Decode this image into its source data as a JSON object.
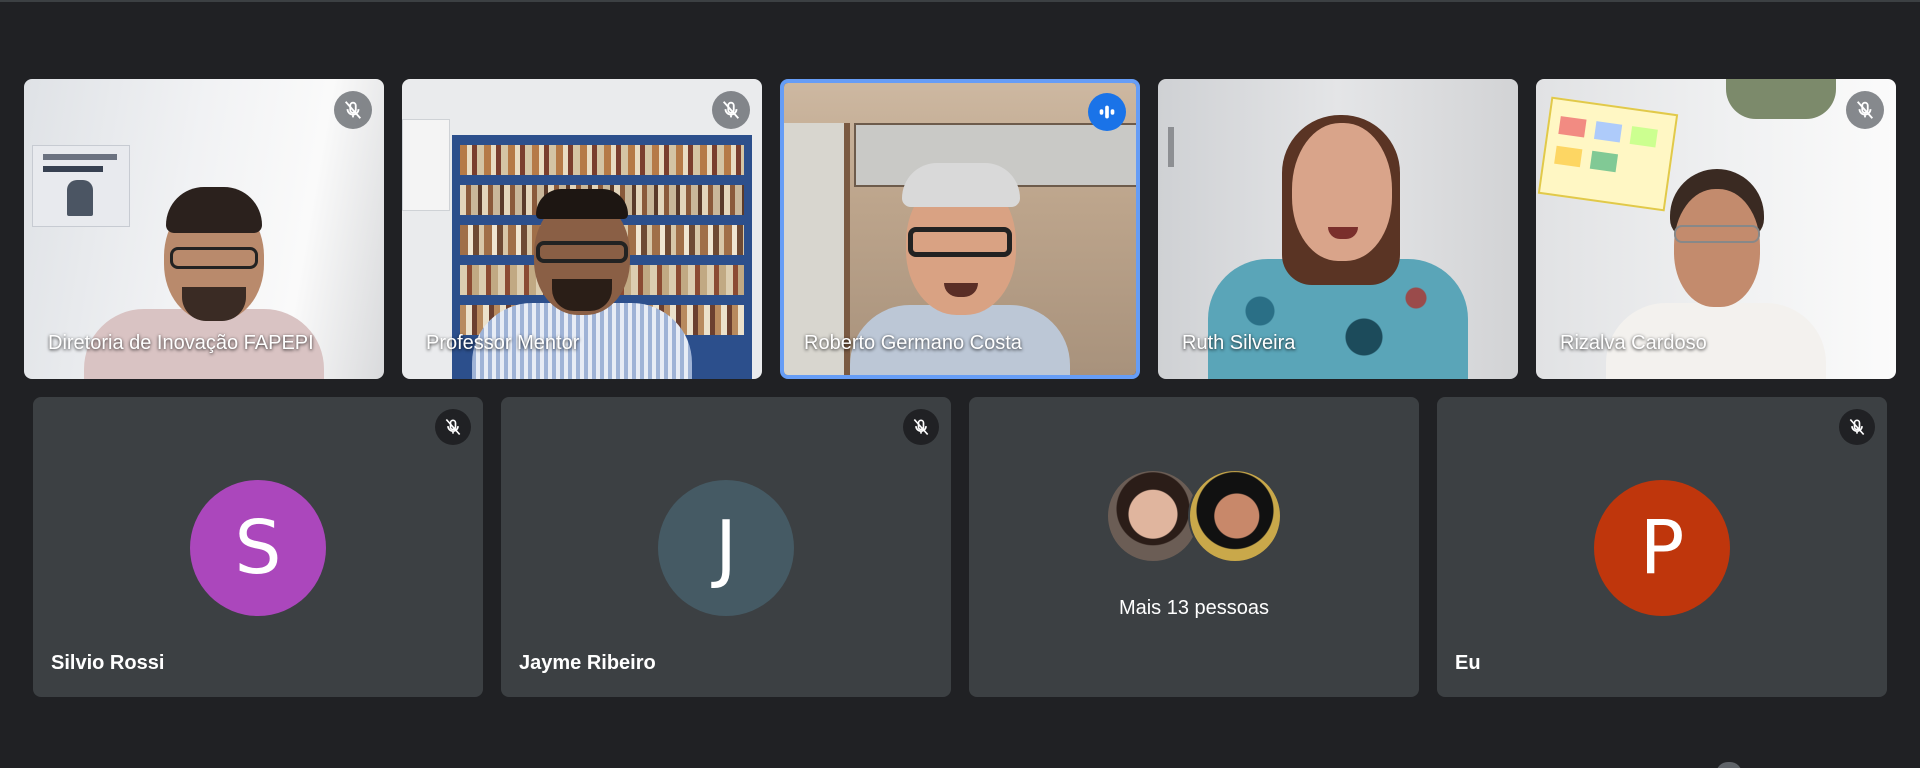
{
  "meeting": {
    "video_tiles": [
      {
        "name": "Diretoria de Inovação FAPEPI",
        "mic": "mic-off-icon",
        "active": false
      },
      {
        "name": "Professor Mentor",
        "mic": "mic-off-icon",
        "active": false
      },
      {
        "name": "Roberto Germano Costa",
        "mic": "speaking-icon",
        "active": true
      },
      {
        "name": "Ruth Silveira",
        "mic": "none",
        "active": false
      },
      {
        "name": "Rizalva Cardoso",
        "mic": "mic-off-icon",
        "active": false
      }
    ],
    "participant_tiles": [
      {
        "name": "Silvio Rossi",
        "initial": "S",
        "avatar_color": "#ab47bc",
        "mic": "mic-off-icon"
      },
      {
        "name": "Jayme Ribeiro",
        "initial": "J",
        "avatar_color": "#455a64",
        "mic": "mic-off-icon"
      },
      {
        "label": "Mais 13 pessoas",
        "avatars": [
          "participant-photo",
          "participant-photo"
        ]
      },
      {
        "name": "Eu",
        "initial": "P",
        "avatar_color": "#bf360c",
        "mic": "mic-off-icon"
      }
    ]
  },
  "colors": {
    "background": "#202124",
    "tile": "#3c4043",
    "speaking_accent": "#1a73e8",
    "active_border": "#669df6"
  }
}
